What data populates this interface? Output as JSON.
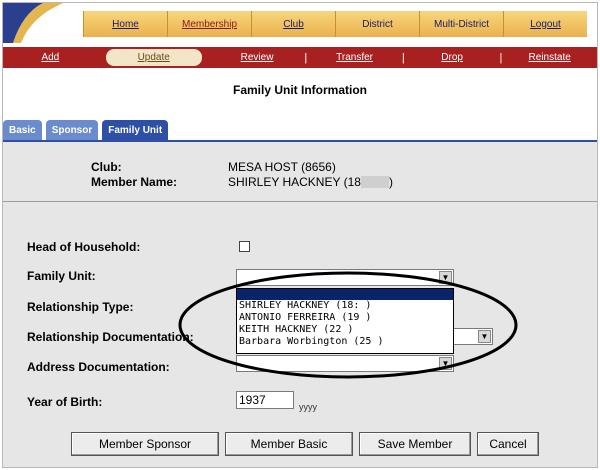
{
  "topnav": {
    "items": [
      "Home",
      "Membership",
      "Club",
      "District",
      "Multi-District",
      "Logout"
    ]
  },
  "subnav": {
    "items": [
      "Add",
      "Update",
      "Review",
      "Transfer",
      "Drop",
      "Reinstate"
    ]
  },
  "page": {
    "title": "Family Unit Information"
  },
  "tabs": [
    "Basic",
    "Sponsor",
    "Family Unit"
  ],
  "info": {
    "club_label": "Club:",
    "club_value": "MESA HOST (8656)",
    "member_label": "Member Name:",
    "member_value": "SHIRLEY HACKNEY (18",
    "member_suffix": ")"
  },
  "form": {
    "head_label": "Head of Household:",
    "family_label": "Family Unit:",
    "relationship_label": "Relationship Type:",
    "relationship_doc_label": "Relationship Documentation:",
    "address_doc_label": "Address Documentation:",
    "yob_label": "Year of Birth:",
    "yob_value": "1937",
    "yob_hint": "yyyy"
  },
  "dropdown": {
    "options": [
      "SHIRLEY HACKNEY (18:     )",
      "ANTONIO FERREIRA (19     )",
      "KEITH HACKNEY (22    )",
      "Barbara Worbington (25       )"
    ]
  },
  "buttons": {
    "sponsor": "Member Sponsor",
    "basic": "Member Basic",
    "save": "Save Member",
    "cancel": "Cancel"
  }
}
